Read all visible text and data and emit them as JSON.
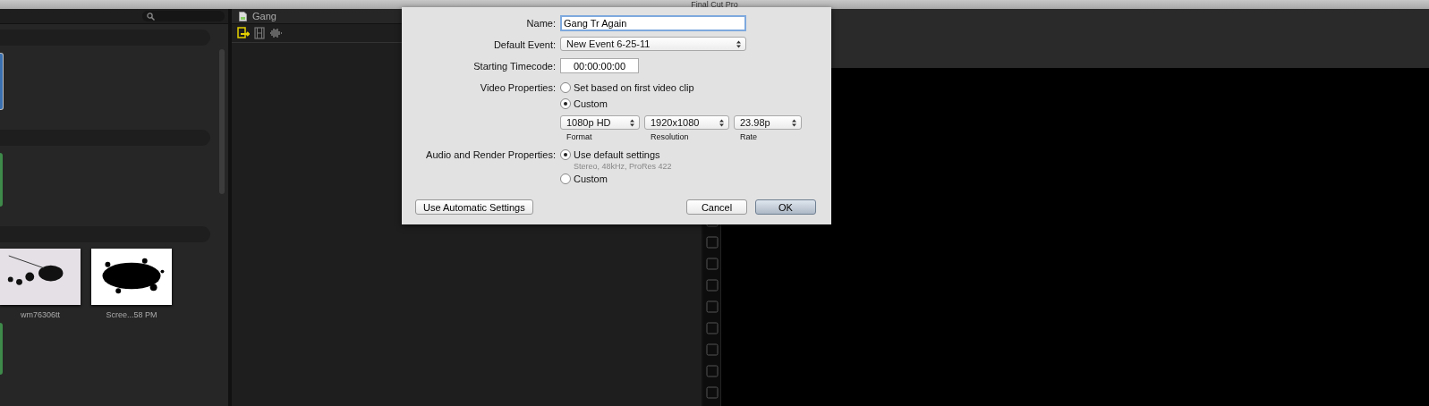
{
  "window": {
    "title": "Final Cut Pro"
  },
  "browser": {
    "clips": [
      {
        "label": "wm76306tt",
        "kind": "splash"
      },
      {
        "label": "Scree...58 PM",
        "kind": "blot"
      }
    ]
  },
  "project": {
    "title": "Gang"
  },
  "dialog": {
    "name": {
      "label": "Name:",
      "value": "Gang Tr Again"
    },
    "default_event": {
      "label": "Default Event:",
      "value": "New Event 6-25-11"
    },
    "starting_timecode": {
      "label": "Starting Timecode:",
      "value": "00:00:00:00"
    },
    "video_properties": {
      "label": "Video Properties:",
      "options": [
        {
          "label": "Set based on first video clip",
          "selected": false
        },
        {
          "label": "Custom",
          "selected": true
        }
      ],
      "popups": [
        {
          "value": "1080p HD",
          "caption": "Format"
        },
        {
          "value": "1920x1080",
          "caption": "Resolution"
        },
        {
          "value": "23.98p",
          "caption": "Rate"
        }
      ]
    },
    "audio_render": {
      "label": "Audio and Render Properties:",
      "options": [
        {
          "label": "Use default settings",
          "detail": "Stereo, 48kHz, ProRes 422",
          "selected": true
        },
        {
          "label": "Custom",
          "selected": false
        }
      ]
    },
    "buttons": [
      {
        "label": "Use Automatic Settings",
        "kind": "left"
      },
      {
        "label": "Cancel",
        "kind": "normal"
      },
      {
        "label": "OK",
        "kind": "default"
      }
    ]
  }
}
